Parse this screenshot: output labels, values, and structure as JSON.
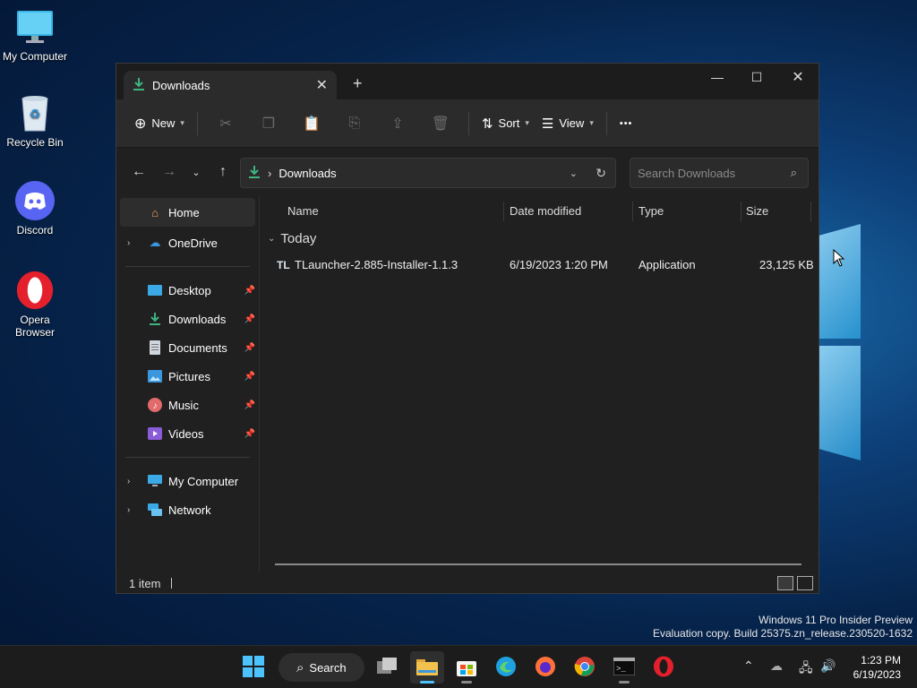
{
  "desktop": {
    "icons": [
      {
        "label": "My Computer",
        "icon": "monitor-icon"
      },
      {
        "label": "Recycle Bin",
        "icon": "recycle-bin-icon"
      },
      {
        "label": "Discord",
        "icon": "discord-icon"
      },
      {
        "label": "Opera Browser",
        "icon": "opera-icon"
      }
    ],
    "watermark_line1": "Windows 11 Pro Insider Preview",
    "watermark_line2": "Evaluation copy. Build 25375.zn_release.230520-1632"
  },
  "explorer": {
    "tab_title": "Downloads",
    "new_tab_glyph": "+",
    "toolbar": {
      "new_label": "New",
      "sort_label": "Sort",
      "view_label": "View",
      "more_glyph": "•••"
    },
    "address": {
      "separator": "›",
      "location": "Downloads"
    },
    "search": {
      "placeholder": "Search Downloads"
    },
    "sidebar": {
      "home": "Home",
      "onedrive": "OneDrive",
      "quick": [
        {
          "label": "Desktop",
          "icon": "desktop-folder-icon"
        },
        {
          "label": "Downloads",
          "icon": "downloads-folder-icon"
        },
        {
          "label": "Documents",
          "icon": "documents-folder-icon"
        },
        {
          "label": "Pictures",
          "icon": "pictures-folder-icon"
        },
        {
          "label": "Music",
          "icon": "music-folder-icon"
        },
        {
          "label": "Videos",
          "icon": "videos-folder-icon"
        }
      ],
      "my_computer": "My Computer",
      "network": "Network"
    },
    "columns": {
      "name": "Name",
      "date": "Date modified",
      "type": "Type",
      "size": "Size"
    },
    "group_label": "Today",
    "files": [
      {
        "name": "TLauncher-2.885-Installer-1.1.3",
        "date": "6/19/2023 1:20 PM",
        "type": "Application",
        "size": "23,125 KB"
      }
    ],
    "status": "1 item"
  },
  "taskbar": {
    "search_label": "Search",
    "time": "1:23 PM",
    "date": "6/19/2023"
  },
  "colors": {
    "accent_green": "#3fb37f",
    "folder_yellow": "#f2c14e",
    "discord": "#5865f2",
    "opera": "#e3202b"
  }
}
